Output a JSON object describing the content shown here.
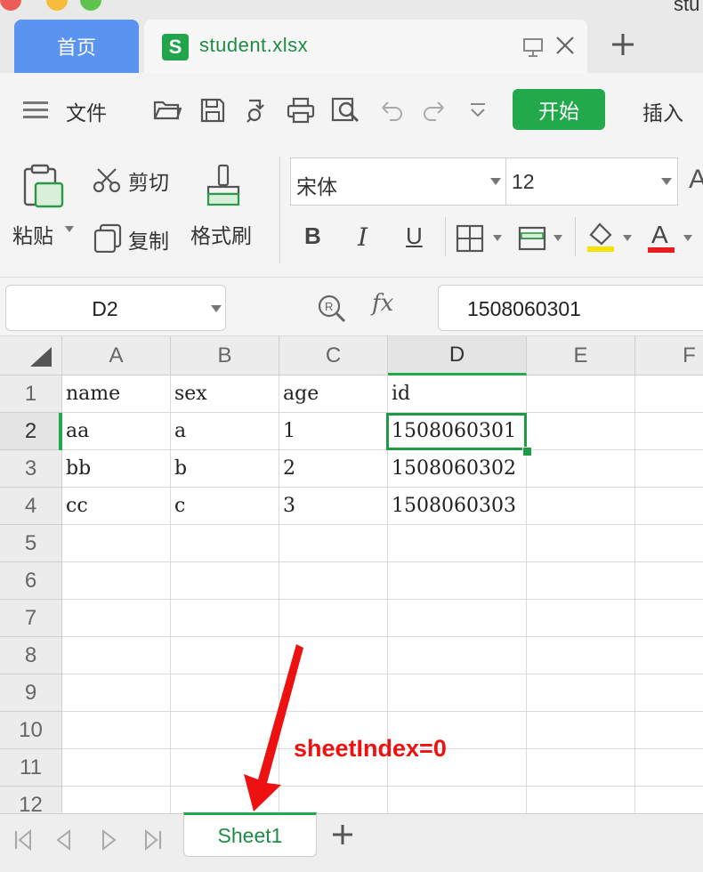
{
  "window": {
    "title_fragment": "stu"
  },
  "tabs": {
    "home_label": "首页",
    "file_name": "student.xlsx",
    "file_icon_letter": "S"
  },
  "ribbon": {
    "menu_label": "文件",
    "start_label": "开始",
    "insert_label": "插入",
    "paste_label": "粘贴",
    "cut_label": "剪切",
    "copy_label": "复制",
    "format_painter_label": "格式刷",
    "font_name": "宋体",
    "font_size": "12",
    "bold_label": "B",
    "italic_label": "I",
    "underline_label": "U",
    "font_color_label": "A",
    "highlight_color": "#f5e400",
    "font_color": "#e81c1c"
  },
  "formula_bar": {
    "cell_ref": "D2",
    "fx_label": "fx",
    "value": "1508060301"
  },
  "sheet": {
    "columns": [
      "A",
      "B",
      "C",
      "D",
      "E",
      "F"
    ],
    "rows": [
      "1",
      "2",
      "3",
      "4",
      "5",
      "6",
      "7",
      "8",
      "9",
      "10",
      "11",
      "12"
    ],
    "cells": [
      [
        "name",
        "sex",
        "age",
        "id"
      ],
      [
        "aa",
        "a",
        "1",
        "1508060301"
      ],
      [
        "bb",
        "b",
        "2",
        "1508060302"
      ],
      [
        "cc",
        "c",
        "3",
        "1508060303"
      ]
    ],
    "selected": "D2",
    "accent_color": "#22a94b"
  },
  "sheet_tabs": {
    "active": "Sheet1"
  },
  "annotation": {
    "text": "sheetIndex=0",
    "color": "#ee1111"
  }
}
